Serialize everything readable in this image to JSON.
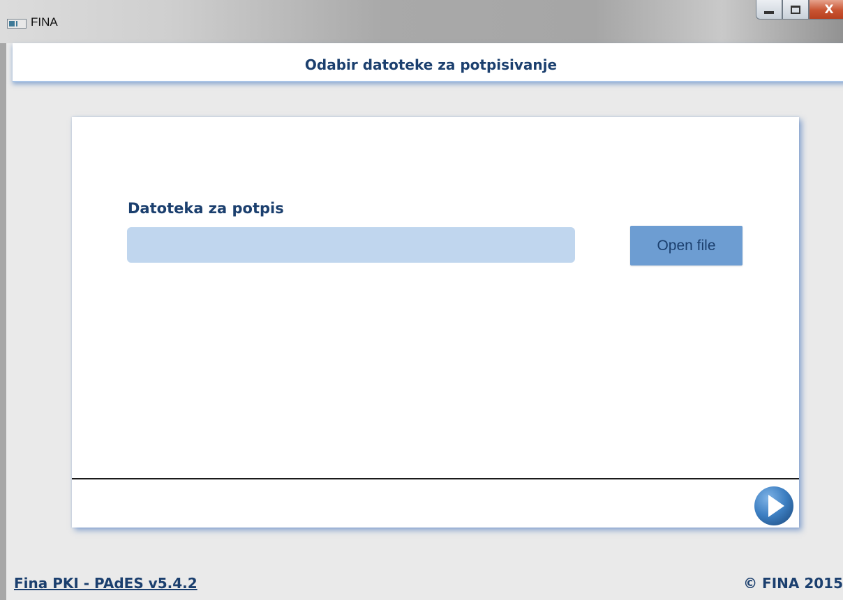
{
  "window": {
    "title": "FINA",
    "controls": {
      "minimize": "minimize",
      "maximize": "maximize",
      "close": "X"
    }
  },
  "header": {
    "title": "Odabir datoteke za potpisivanje"
  },
  "form": {
    "file_label": "Datoteka za potpis",
    "file_value": "",
    "open_button_label": "Open file"
  },
  "navigation": {
    "next_icon": "play-arrow-icon"
  },
  "footer": {
    "version_link": "Fina PKI - PAdES  v5.4.2",
    "copyright": "© FINA 2015"
  },
  "colors": {
    "accent": "#1b3f6e",
    "input_bg": "#c0d6ee",
    "button_bg": "#6d9dd2",
    "next_icon": "#3d7fc2"
  }
}
